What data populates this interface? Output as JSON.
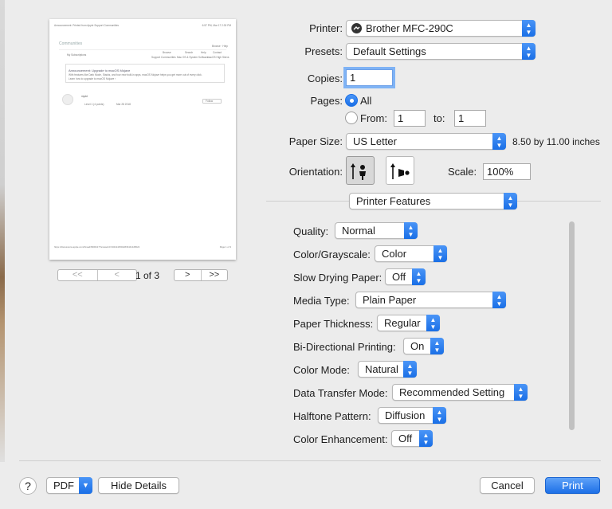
{
  "preview": {
    "page_header_left": "Announcement: Printed from Apple Support Communities",
    "page_header_right": "6:57 PM, Mar 17 2:30 PM",
    "community_title": "Communities",
    "nav_left": "Browse · Help",
    "nav_items": [
      "My Subscriptions",
      "Browse",
      "Search",
      "Help",
      "Contact"
    ],
    "nav_sub": [
      "Support Communities",
      "Mac OS & System Software",
      "macOS High Sierra"
    ],
    "announcement_title": "Announcement: Upgrade to macOS Mojave",
    "announcement_body_1": "With features like Dark Mode, Stacks, and four new built-in apps, macOS Mojave helps you get more out of every click.",
    "announcement_body_2": "Learn how to upgrade to macOS Mojave ›",
    "post_user": "mydd",
    "post_level": "Level 1 (4 points)",
    "post_date": "Mar 28 2018",
    "post_button": "Follow",
    "footer_left": "https://discussions.apple.com/thread/8306417?answerId=33441445022#33441445022",
    "footer_right": "Page 1 of 3"
  },
  "pager": {
    "first": "<<",
    "prev": "<",
    "next": ">",
    "last": ">>",
    "count": "1 of 3"
  },
  "printer": {
    "label": "Printer:",
    "value": "Brother MFC-290C"
  },
  "presets": {
    "label": "Presets:",
    "value": "Default Settings"
  },
  "copies": {
    "label": "Copies:",
    "value": "1"
  },
  "pages": {
    "label": "Pages:",
    "all_label": "All",
    "from_label": "From:",
    "from_value": "1",
    "to_label": "to:",
    "to_value": "1",
    "selected": "All"
  },
  "paper": {
    "label": "Paper Size:",
    "value": "US Letter",
    "dimensions": "8.50 by 11.00 inches"
  },
  "orientation": {
    "label": "Orientation:",
    "selected": "portrait"
  },
  "scale": {
    "label": "Scale:",
    "value": "100%"
  },
  "section": {
    "value": "Printer Features"
  },
  "features": [
    {
      "label": "Quality:",
      "value": "Normal"
    },
    {
      "label": "Color/Grayscale:",
      "value": "Color"
    },
    {
      "label": "Slow Drying Paper:",
      "value": "Off"
    },
    {
      "label": "Media Type:",
      "value": "Plain Paper"
    },
    {
      "label": "Paper Thickness:",
      "value": "Regular"
    },
    {
      "label": "Bi-Directional Printing:",
      "value": "On"
    },
    {
      "label": "Color Mode:",
      "value": "Natural"
    },
    {
      "label": "Data Transfer Mode:",
      "value": "Recommended Setting"
    },
    {
      "label": "Halftone Pattern:",
      "value": "Diffusion"
    },
    {
      "label": "Color Enhancement:",
      "value": "Off"
    }
  ],
  "footer": {
    "help": "?",
    "pdf": "PDF",
    "details": "Hide Details",
    "cancel": "Cancel",
    "print": "Print"
  },
  "colors": {
    "accent": "#1a6fe6",
    "focus_ring": "#7fb3f5"
  },
  "icons": [
    "printer-icon",
    "popup-arrows-icon",
    "portrait-orientation-icon",
    "landscape-orientation-icon",
    "help-icon",
    "chevron-down-icon"
  ]
}
